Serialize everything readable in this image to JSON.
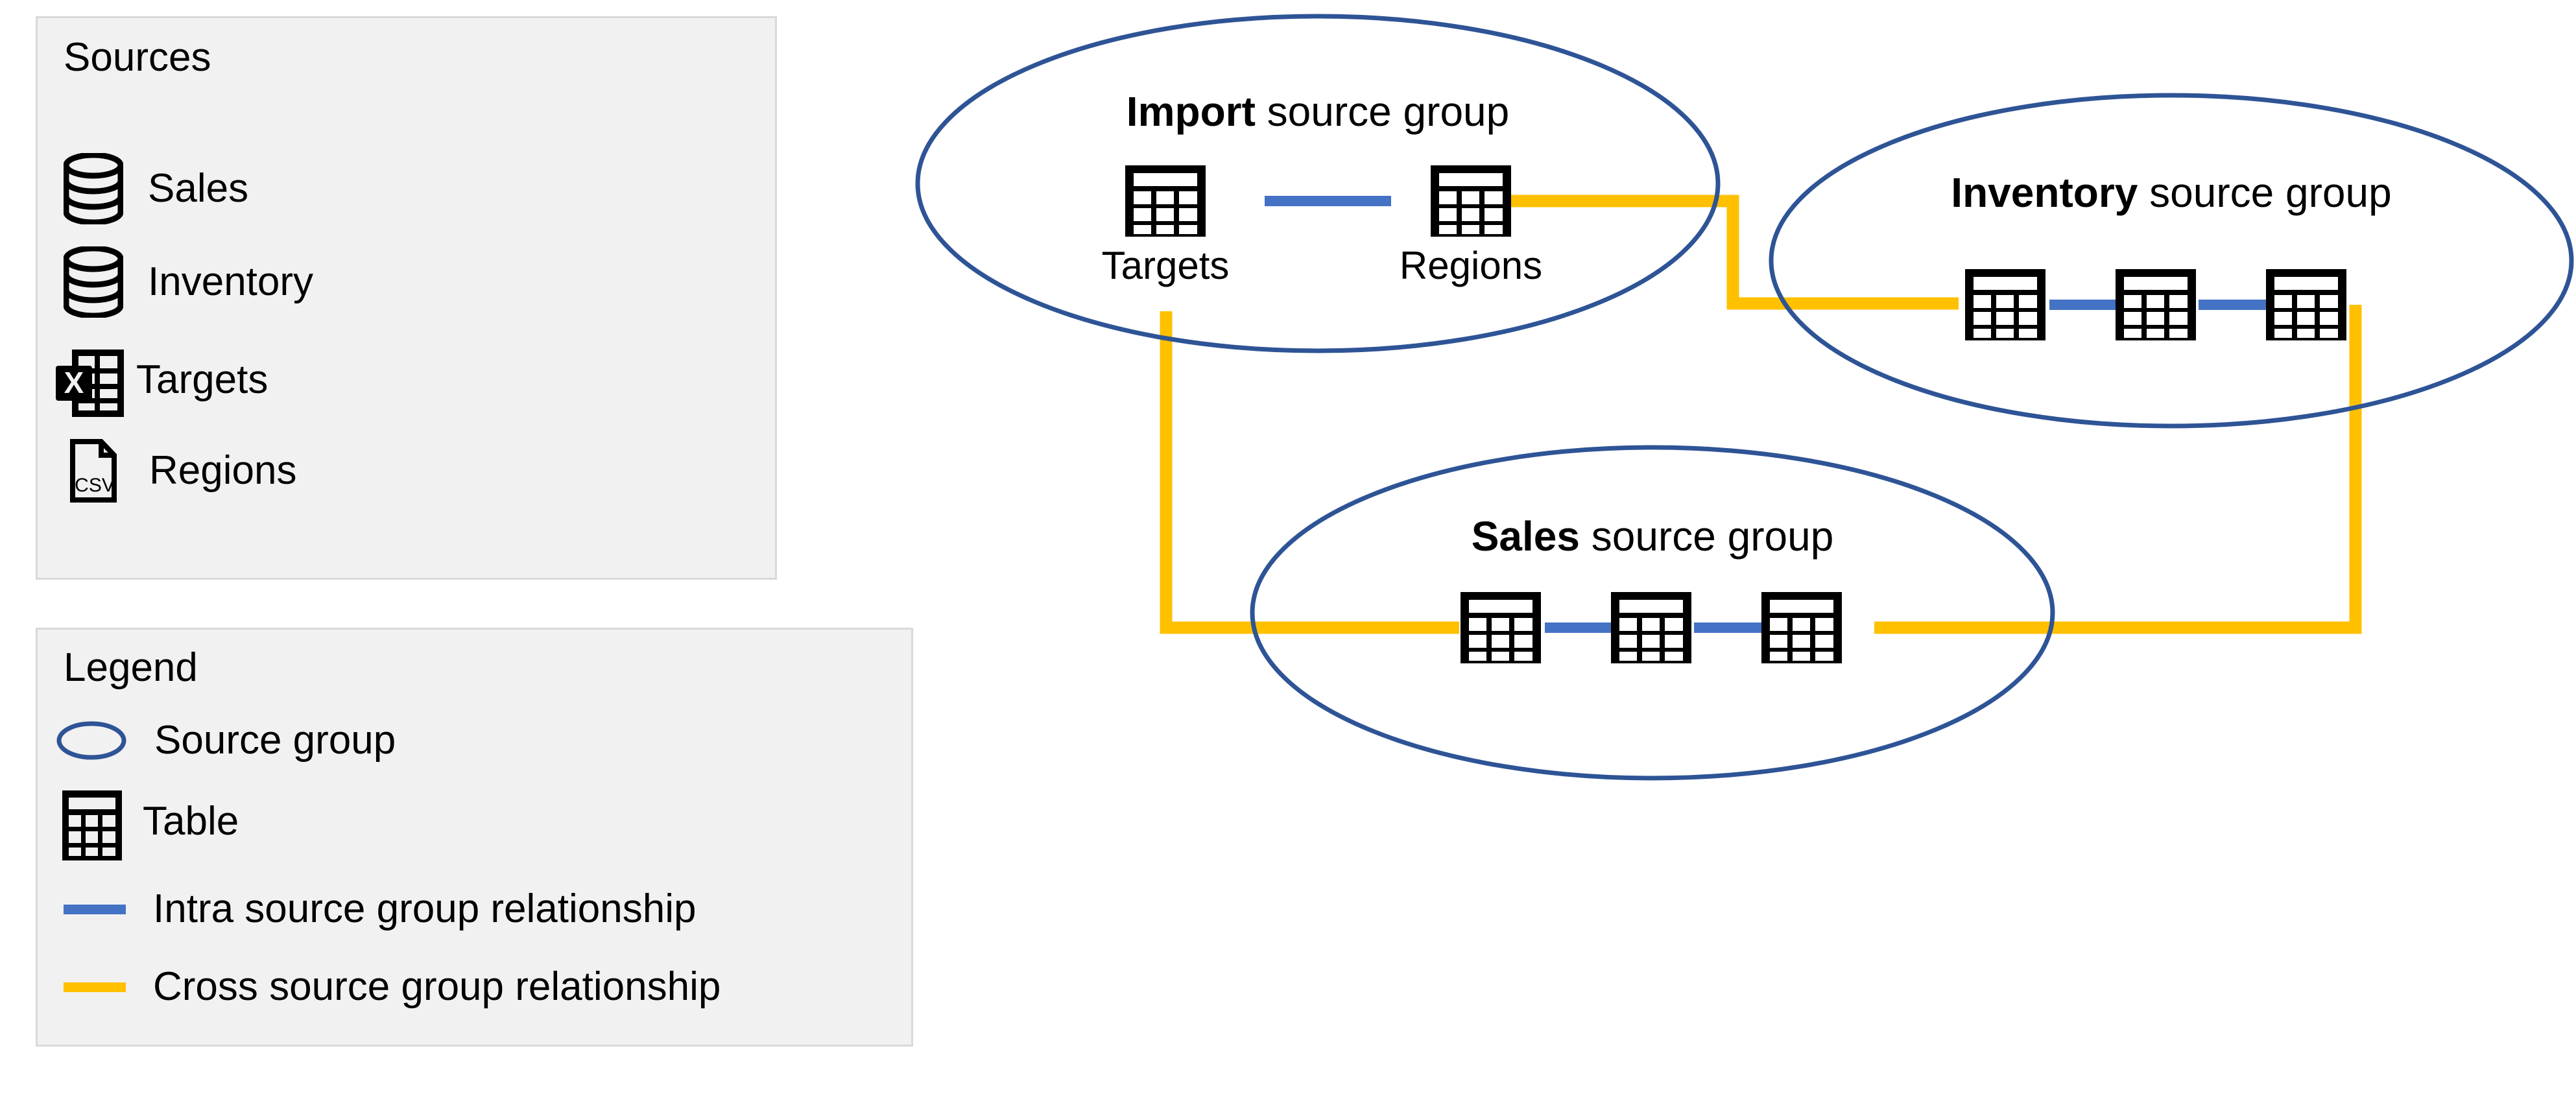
{
  "sources_panel": {
    "title": "Sources",
    "items": [
      {
        "label": "Sales",
        "icon": "database-icon"
      },
      {
        "label": "Inventory",
        "icon": "database-icon"
      },
      {
        "label": "Targets",
        "icon": "excel-file-icon"
      },
      {
        "label": "Regions",
        "icon": "csv-file-icon"
      }
    ]
  },
  "legend_panel": {
    "title": "Legend",
    "items": [
      {
        "label": "Source group",
        "icon": "ellipse-icon"
      },
      {
        "label": "Table",
        "icon": "table-icon"
      },
      {
        "label": "Intra source group relationship",
        "icon": "blue-line-icon"
      },
      {
        "label": "Cross source group relationship",
        "icon": "orange-line-icon"
      }
    ]
  },
  "diagram": {
    "groups": [
      {
        "id": "import",
        "name_bold": "Import",
        "name_rest": " source group",
        "tables": [
          {
            "label": "Targets"
          },
          {
            "label": "Regions"
          }
        ]
      },
      {
        "id": "inventory",
        "name_bold": "Inventory",
        "name_rest": " source group",
        "tables": [
          {
            "label": ""
          },
          {
            "label": ""
          },
          {
            "label": ""
          }
        ]
      },
      {
        "id": "sales",
        "name_bold": "Sales",
        "name_rest": " source group",
        "tables": [
          {
            "label": ""
          },
          {
            "label": ""
          },
          {
            "label": ""
          }
        ]
      }
    ],
    "relationships": {
      "intra": [
        {
          "group": "import",
          "from": "Targets",
          "to": "Regions"
        },
        {
          "group": "inventory",
          "from": "table-1",
          "to": "table-2"
        },
        {
          "group": "inventory",
          "from": "table-2",
          "to": "table-3"
        },
        {
          "group": "sales",
          "from": "table-1",
          "to": "table-2"
        },
        {
          "group": "sales",
          "from": "table-2",
          "to": "table-3"
        }
      ],
      "cross": [
        {
          "from_group": "import",
          "to_group": "inventory"
        },
        {
          "from_group": "import",
          "to_group": "sales"
        },
        {
          "from_group": "inventory",
          "to_group": "sales"
        }
      ]
    }
  },
  "colors": {
    "intra_relationship": "#4472C4",
    "cross_relationship": "#FFC000",
    "group_outline": "#2E5496",
    "panel_fill": "#F1F1F1",
    "panel_border": "#D9D9D9",
    "icon": "#000000"
  }
}
